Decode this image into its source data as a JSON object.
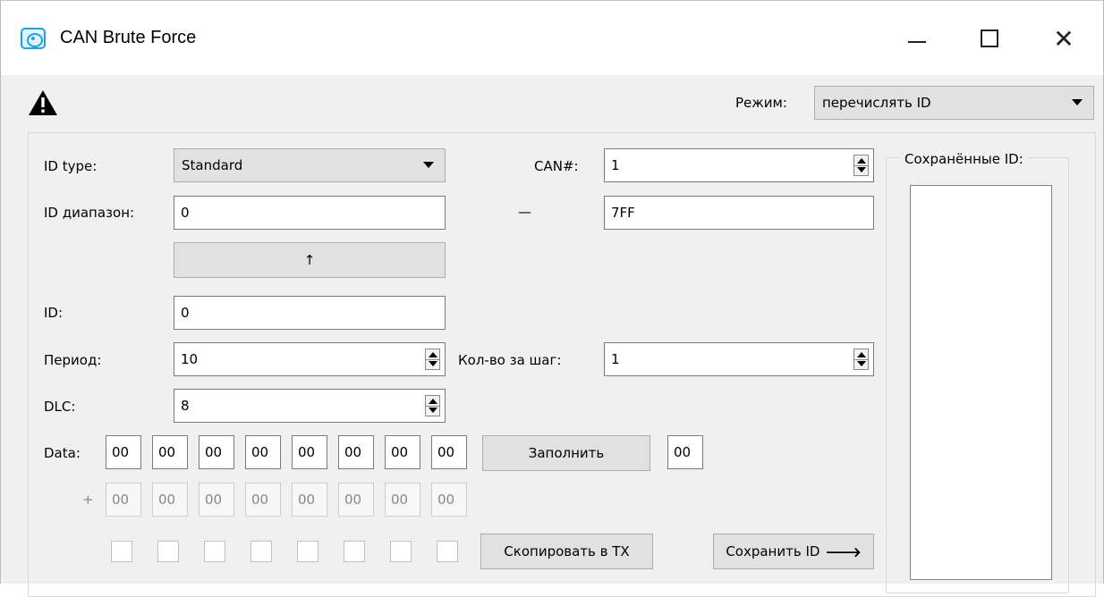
{
  "window": {
    "title": "CAN Brute Force",
    "icon": "can-brute-force-app-icon",
    "controls": {
      "minimize": "minimize-icon",
      "maximize": "maximize-icon",
      "close": "✕"
    }
  },
  "toolbar": {
    "warning_icon": "warning-triangle-icon",
    "mode_label": "Режим:",
    "mode_value": "перечислять ID"
  },
  "form": {
    "id_type_label": "ID type:",
    "id_type_value": "Standard",
    "can_label": "CAN#:",
    "can_value": "1",
    "id_range_label": "ID диапазон:",
    "id_range_from": "0",
    "id_range_dash": "—",
    "id_range_to": "7FF",
    "up_button": "↑",
    "id_label": "ID:",
    "id_value": "0",
    "period_label": "Период:",
    "period_value": "10",
    "per_step_label": "Кол-во за шаг:",
    "per_step_value": "1",
    "dlc_label": "DLC:",
    "dlc_value": "8",
    "data_label": "Data:",
    "data_bytes": [
      "00",
      "00",
      "00",
      "00",
      "00",
      "00",
      "00",
      "00"
    ],
    "fill_button": "Заполнить",
    "fill_value": "00",
    "plus_label": "+",
    "increment_bytes": [
      "00",
      "00",
      "00",
      "00",
      "00",
      "00",
      "00",
      "00"
    ],
    "byte_checkboxes": [
      false,
      false,
      false,
      false,
      false,
      false,
      false,
      false
    ],
    "copy_tx_button": "Скопировать в TX",
    "save_id_button": "Сохранить ID",
    "save_id_arrow": "🡒"
  },
  "saved": {
    "legend": "Сохранённые ID:",
    "items": []
  }
}
